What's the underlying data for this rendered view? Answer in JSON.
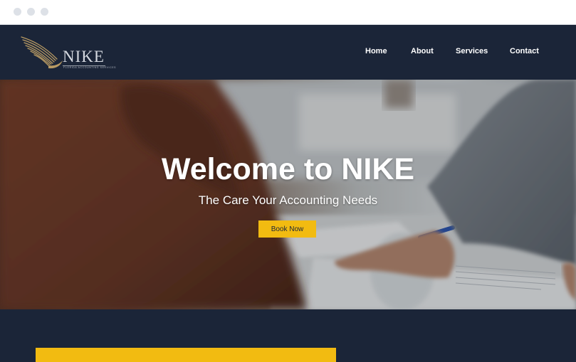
{
  "brand": {
    "name": "NIKE",
    "tagline": "FLORIDA ACCOUNTING SERVICES",
    "logo_icon": "wings-icon",
    "colors": {
      "navy": "#1b2538",
      "gold": "#f2bb11",
      "white": "#ffffff"
    }
  },
  "nav": {
    "items": [
      {
        "label": "Home"
      },
      {
        "label": "About"
      },
      {
        "label": "Services"
      },
      {
        "label": "Contact"
      }
    ]
  },
  "hero": {
    "title": "Welcome to NIKE",
    "subtitle": "The Care Your Accounting Needs",
    "cta_label": "Book Now"
  }
}
